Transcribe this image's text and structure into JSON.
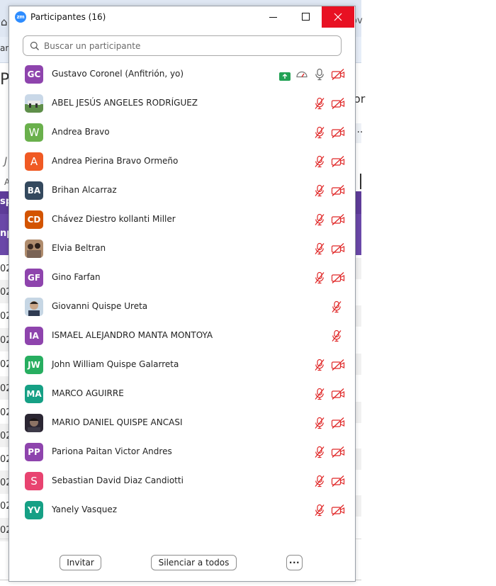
{
  "background": {
    "bookmark_label": "am",
    "page_letter": "P",
    "right_letter": "or",
    "right_dots": "...",
    "italic_letter": "J",
    "a_letter": "A",
    "purple_header_text": "sp",
    "purple_body_text": "np",
    "tabbar_right": "ov",
    "row_texts": [
      "02",
      "02",
      "02",
      "02",
      "02",
      "02",
      "02",
      "02",
      "02",
      "02",
      "02",
      "02"
    ]
  },
  "window": {
    "title": "Participantes (16)",
    "app_logo": "zm"
  },
  "search": {
    "placeholder": "Buscar un participante",
    "value": ""
  },
  "participants": [
    {
      "name": "Gustavo Coronel (Anfitrión, yo)",
      "initials": "GC",
      "color": "#8e44ad",
      "host": true,
      "mic_muted": false,
      "video_off": true
    },
    {
      "name": "ABEL JESÚS ANGELES RODRÍGUEZ",
      "initials": "",
      "photo": "photo-field",
      "mic_muted": true,
      "video_off": true
    },
    {
      "name": "Andrea Bravo",
      "initials": "W",
      "color": "#6ab04c",
      "mic_muted": true,
      "video_off": true
    },
    {
      "name": "Andrea Pierina Bravo Ormeño",
      "initials": "A",
      "color": "#f05a24",
      "mic_muted": true,
      "video_off": true
    },
    {
      "name": "Brihan Alcarraz",
      "initials": "BA",
      "color": "#34495e",
      "mic_muted": true,
      "video_off": true
    },
    {
      "name": "Chávez Diestro kollanti Miller",
      "initials": "CD",
      "color": "#d35400",
      "mic_muted": true,
      "video_off": true
    },
    {
      "name": "Elvia Beltran",
      "initials": "",
      "photo": "photo-group",
      "mic_muted": true,
      "video_off": true
    },
    {
      "name": "Gino Farfan",
      "initials": "GF",
      "color": "#8e44ad",
      "mic_muted": true,
      "video_off": true
    },
    {
      "name": "Giovanni Quispe Ureta",
      "initials": "",
      "photo": "photo-person",
      "mic_muted": true,
      "video_off": false
    },
    {
      "name": "ISMAEL ALEJANDRO MANTA MONTOYA",
      "initials": "IA",
      "color": "#8e44ad",
      "mic_muted": true,
      "video_off": false
    },
    {
      "name": "John William Quispe Galarreta",
      "initials": "JW",
      "color": "#27ae60",
      "mic_muted": true,
      "video_off": true
    },
    {
      "name": "MARCO AGUIRRE",
      "initials": "MA",
      "color": "#16a085",
      "mic_muted": true,
      "video_off": true
    },
    {
      "name": "MARIO DANIEL QUISPE ANCASI",
      "initials": "",
      "photo": "photo-dark",
      "mic_muted": true,
      "video_off": true
    },
    {
      "name": "Pariona Paitan Victor Andres",
      "initials": "PP",
      "color": "#8e44ad",
      "mic_muted": true,
      "video_off": true
    },
    {
      "name": "Sebastian David Diaz Candiotti",
      "initials": "S",
      "color": "#e84370",
      "mic_muted": true,
      "video_off": true
    },
    {
      "name": "Yanely Vasquez",
      "initials": "YV",
      "color": "#16a085",
      "mic_muted": true,
      "video_off": true
    }
  ],
  "footer": {
    "invite_label": "Invitar",
    "mute_all_label": "Silenciar a todos",
    "more_label": "···"
  },
  "colors": {
    "muted_red": "#e02828",
    "close_red": "#e81123",
    "share_green": "#23a255",
    "zoom_blue": "#2d8cff"
  }
}
